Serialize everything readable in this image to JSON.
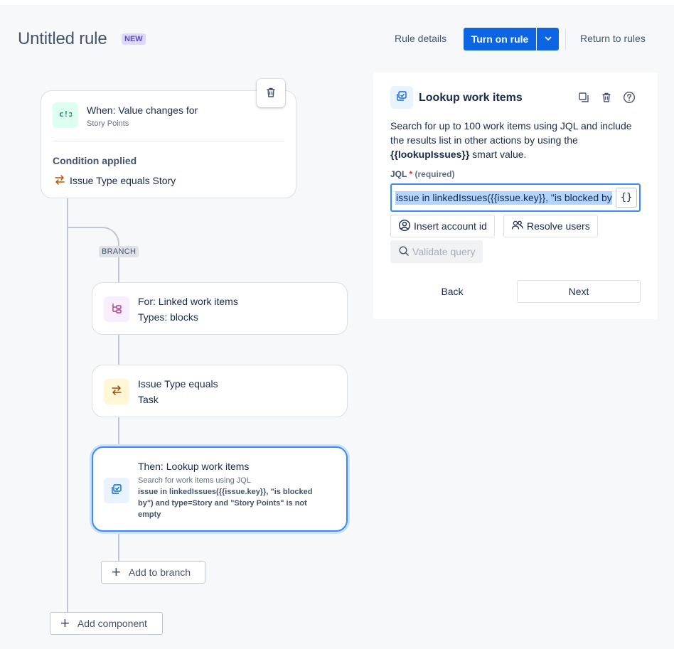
{
  "header": {
    "title": "Untitled rule",
    "badge": "NEW",
    "rule_details": "Rule details",
    "turn_on": "Turn on rule",
    "return": "Return to rules"
  },
  "trigger": {
    "title": "When: Value changes for",
    "subtitle": "Story Points",
    "condition_label": "Condition applied",
    "condition_text": "Issue Type equals Story"
  },
  "branch_tag": "BRANCH",
  "branch": {
    "title": "For: Linked work items",
    "subtitle": "Types: blocks"
  },
  "condition": {
    "title": "Issue Type equals",
    "subtitle": "Task"
  },
  "action": {
    "title": "Then: Lookup work items",
    "subtitle": "Search for work items using JQL",
    "jql_line1": "issue in linkedIssues({{issue.key}}, \"is blocked",
    "jql_line2": "by\") and type=Story and \"Story Points\" is not",
    "jql_line3": "empty"
  },
  "add_to_branch": "Add to branch",
  "add_component": "Add component",
  "panel": {
    "title": "Lookup work items",
    "desc_1": "Search for up to 100 work items using JQL and include the results list in other actions by using the ",
    "desc_smart": "{{lookupIssues}}",
    "desc_2": " smart value.",
    "jql_label": "JQL",
    "required_star": "*",
    "required_text": "(required)",
    "jql_value": "issue in linkedIssues({{issue.key}}, \"is blocked by\") and type=Story and \"Story Points\" is not empty",
    "braces": "{}",
    "insert_account": "Insert account id",
    "resolve_users": "Resolve users",
    "validate": "Validate query",
    "back": "Back",
    "next": "Next"
  },
  "colors": {
    "primary": "#0c66e4",
    "selected_border": "#388bff",
    "trigger_icon_bg": "#dcfff1",
    "branch_icon_bg": "#f8eefe",
    "condition_icon_bg": "#fff7d6",
    "action_icon_bg": "#e9f2ff"
  }
}
